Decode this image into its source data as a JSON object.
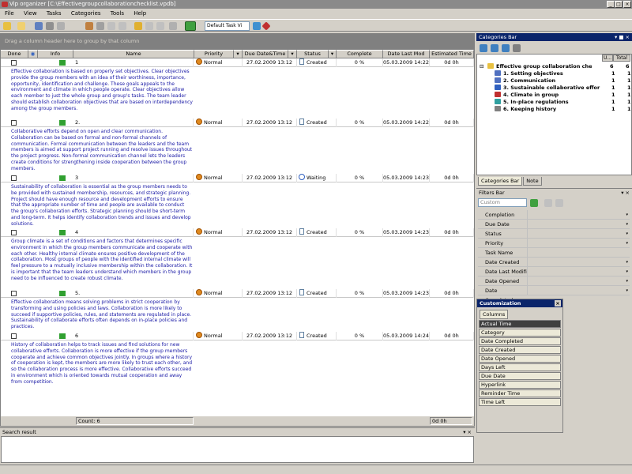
{
  "window": {
    "title": "Vip organizer [C:\\Effectivegroupcollaborationchecklist.vpdb]",
    "buttons": [
      "_",
      "□",
      "×"
    ]
  },
  "menu": [
    "File",
    "View",
    "Tasks",
    "Categories",
    "Tools",
    "Help"
  ],
  "toolbar": {
    "view_combo": "Default Task Vi",
    "icons": [
      "new-icon",
      "open-icon",
      "save-icon",
      "print-icon",
      "cut-icon",
      "copy-icon",
      "paste-icon",
      "undo-icon",
      "redo-icon",
      "flag-icon",
      "delete-icon"
    ]
  },
  "grid": {
    "group_panel": "Drag a column header here to group by that column",
    "columns": [
      "Done",
      "",
      "Info",
      "Name",
      "",
      "Priority",
      "",
      "Due Date&Time",
      "",
      "Status",
      "",
      "Complete",
      "Date Last Mod",
      "Estimated Time"
    ],
    "rows": [
      {
        "name": "1",
        "priority": "Normal",
        "due": "27.02.2009 13:12",
        "status": "Created",
        "complete": "0 %",
        "modified": "05.03.2009 14:22",
        "estimated": "0d 0h",
        "note": "Effective collaboration is based on properly set objectives. Clear objectives provide the group members with an idea of their worthiness, importance, opportunity, identification and challenge. These goals appeals to the environment and climate in which people operate. Clear objectives allow each member to just the whole group and group's tasks. The team leader should establish collaboration objectives that are based on interdependency among the group members."
      },
      {
        "name": "2.",
        "priority": "Normal",
        "due": "27.02.2009 13:12",
        "status": "Created",
        "complete": "0 %",
        "modified": "05.03.2009 14:22",
        "estimated": "0d 0h",
        "note": "Collaborative efforts depend on open and clear communication. Collaboration can be based on formal and non-formal channels of communication. Formal communication between the leaders and the team members is aimed at support project running and resolve issues throughout the project progress. Non-formal communication channel lets the leaders create conditions for strengthening inside cooperation between the group members."
      },
      {
        "name": "3",
        "priority": "Normal",
        "due": "27.02.2009 13:12",
        "status": "Waiting",
        "complete": "0 %",
        "modified": "05.03.2009 14:23",
        "estimated": "0d 0h",
        "note": "Sustainability of collaboration is essential as the group members needs to be provided with sustained membership, resources, and strategic planning. Project should have enough resource and development efforts to ensure that the appropriate number of time and people are available to conduct the group's collaboration efforts. Strategic planning should be short-term and long-term. It helps identify collaboration trends and issues and develop solutions."
      },
      {
        "name": "4",
        "priority": "Normal",
        "due": "27.02.2009 13:12",
        "status": "Created",
        "complete": "0 %",
        "modified": "05.03.2009 14:23",
        "estimated": "0d 0h",
        "note": "Group climate is a set of conditions and factors that determines specific environment in which the group members communicate and cooperate with each other. Healthy internal climate ensures positive development of the collaboration. Most groups of people with the identified internal climate will feel pressure to a mutually inclusive membership within the collaboration. It is important that the team leaders understand which members in the group need to be influenced to create robust climate."
      },
      {
        "name": "5.",
        "priority": "Normal",
        "due": "27.02.2009 13:12",
        "status": "Created",
        "complete": "0 %",
        "modified": "05.03.2009 14:23",
        "estimated": "0d 0h",
        "note": "Effective collaboration means solving problems in strict cooperation by transforming and using policies and laws. Collaboration is more likely to succeed if supportive policies, rules, and statements are regulated in place. Sustainability of collaborate efforts often depends on in-place policies and practices."
      },
      {
        "name": "6",
        "priority": "Normal",
        "due": "27.02.2009 13:12",
        "status": "Created",
        "complete": "0 %",
        "modified": "05.03.2009 14:24",
        "estimated": "0d 0h",
        "note": "History of collaboration helps to track issues and find solutions for new collaborative efforts. Collaboration is more effective if the group members cooperate and achieve common objectives jointly. In groups where a history of cooperation is kept, the members are more likely to trust each other, and so the collaboration process is more effective. Collaborative efforts succeed in environment which is oriented towards mutual cooperation and away from competition."
      }
    ],
    "footer_count": "Count: 6",
    "footer_time": "0d 0h"
  },
  "search": {
    "title": "Search result",
    "pin": "▾ ×"
  },
  "categories": {
    "title": "Categories Bar",
    "controls": "▾ ■ ×",
    "col_u": "U...",
    "col_total": "Total",
    "items": [
      {
        "label": "Effective group collaboration che",
        "u": "6",
        "total": "6",
        "icon": "#e8c040"
      },
      {
        "label": "1. Setting objectives",
        "u": "1",
        "total": "1",
        "icon": "#5070c0"
      },
      {
        "label": "2. Communication",
        "u": "1",
        "total": "1",
        "icon": "#5070c0"
      },
      {
        "label": "3. Sustainable collaborative effor",
        "u": "1",
        "total": "1",
        "icon": "#3060c0"
      },
      {
        "label": "4. Climate in group",
        "u": "1",
        "total": "1",
        "icon": "#c03030"
      },
      {
        "label": "5. In-place regulations",
        "u": "1",
        "total": "1",
        "icon": "#30a0a0"
      },
      {
        "label": "6. Keeping history",
        "u": "1",
        "total": "1",
        "icon": "#808080"
      }
    ],
    "tabs": [
      "Categories Bar",
      "Note"
    ]
  },
  "filters": {
    "title": "Filters Bar",
    "controls": "▾ ×",
    "combo": "Custom",
    "rows": [
      "Completion",
      "Due Date",
      "Status",
      "Priority",
      "Task Name",
      "Date Created",
      "Date Last Modifi",
      "Date Opened",
      "Date Completed"
    ]
  },
  "customization": {
    "title": "Customization",
    "close": "×",
    "tab": "Columns",
    "items": [
      "Actual Time",
      "Category",
      "Date Completed",
      "Date Created",
      "Date Opened",
      "Days Left",
      "Due Date",
      "Hyperlink",
      "Reminder Time",
      "Time Left"
    ]
  }
}
